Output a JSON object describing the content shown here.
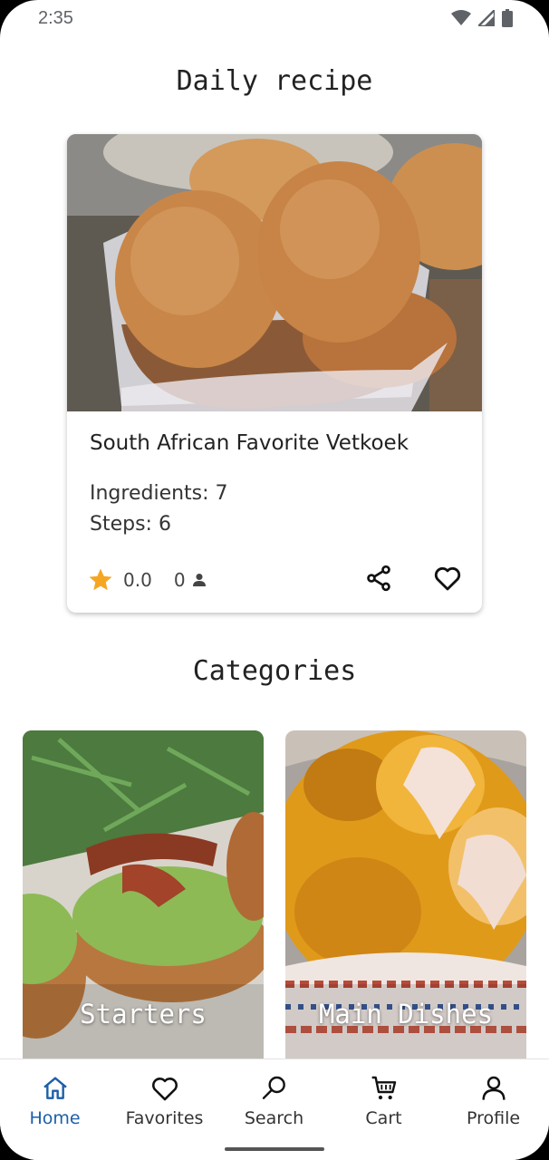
{
  "status_bar": {
    "time": "2:35"
  },
  "daily": {
    "heading": "Daily recipe",
    "recipe": {
      "name": "South African Favorite Vetkoek",
      "ingredients": "Ingredients: 7",
      "steps": "Steps: 6",
      "rating": "0.0",
      "reviews": "0"
    }
  },
  "categories": {
    "heading": "Categories",
    "items": [
      {
        "label": "Starters"
      },
      {
        "label": "Main Dishes"
      }
    ]
  },
  "nav": {
    "items": [
      {
        "label": "Home",
        "icon": "home-icon",
        "active": true
      },
      {
        "label": "Favorites",
        "icon": "heart-icon"
      },
      {
        "label": "Search",
        "icon": "search-icon"
      },
      {
        "label": "Cart",
        "icon": "cart-icon"
      },
      {
        "label": "Profile",
        "icon": "person-icon"
      }
    ]
  },
  "colors": {
    "accent": "#1c5fa8",
    "star": "#f5a623"
  }
}
